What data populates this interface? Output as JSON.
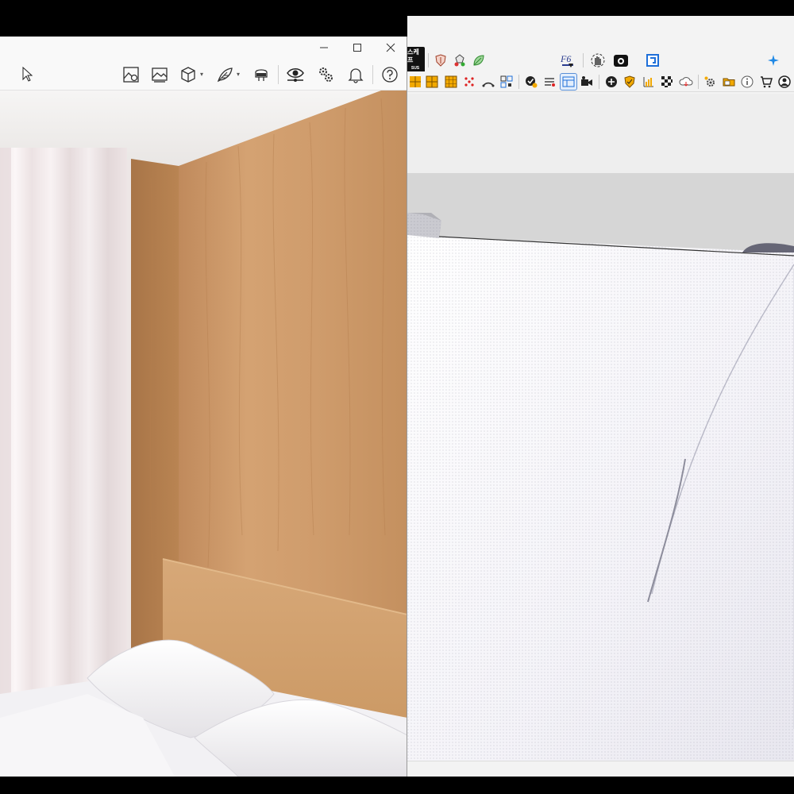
{
  "sketchup": {
    "toolbar1_tag": "스케프",
    "toolbar1_tag_sub": "SUS",
    "toolbar1_icons": [
      "shield-icon",
      "bucket-icon",
      "leaf-icon",
      "font-icon",
      "hand-gear-icon",
      "camera-icon",
      "frame-icon",
      "sparkle-icon"
    ],
    "toolbar2_icons": [
      "grid-icon",
      "grid-icon",
      "grid-icon",
      "scatter-icon",
      "arc-icon",
      "qr-icon",
      "check-badge-icon",
      "list-icon",
      "layout-icon",
      "camera-icon",
      "plus-circle-icon",
      "shield-icon",
      "chart-icon",
      "checker-icon",
      "cloud-icon",
      "gear-icon",
      "folder-icon",
      "info-icon",
      "cart-icon",
      "user-icon"
    ]
  },
  "render_window": {
    "title_controls": [
      "minimize-icon",
      "maximize-icon",
      "close-icon"
    ],
    "toolbar_icons": [
      "cursor-icon",
      "picture-settings-icon",
      "image-icon",
      "cube-icon",
      "feather-icon",
      "vr-headset-icon",
      "eye-icon",
      "gears-icon",
      "bell-icon",
      "help-icon"
    ]
  }
}
